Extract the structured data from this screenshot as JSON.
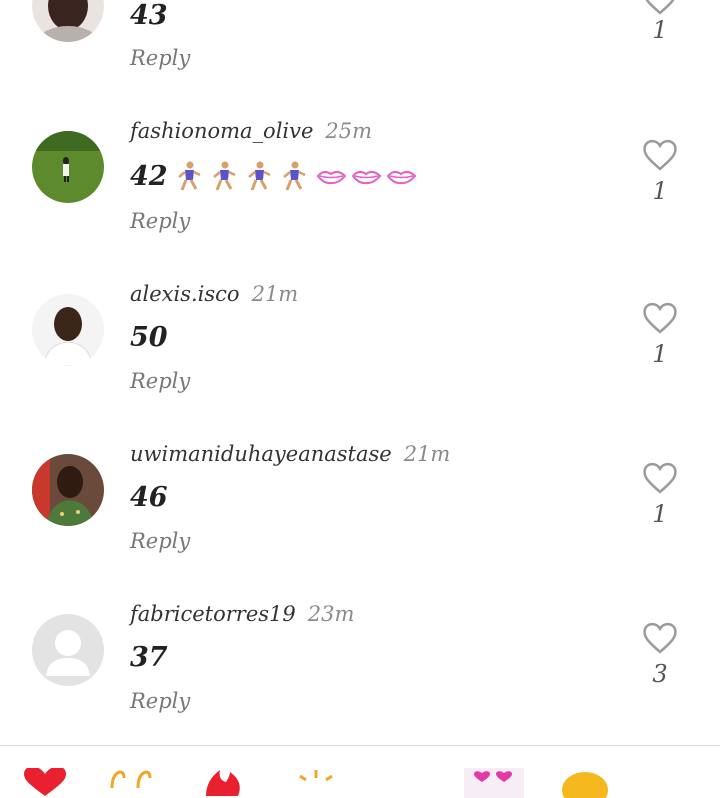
{
  "comments": [
    {
      "username": "",
      "time": "",
      "text": "43",
      "reply_label": "Reply",
      "likes": "1",
      "avatar_icon": "person-photo-icon"
    },
    {
      "username": "fashionoma_olive",
      "time": "25m",
      "text": "42",
      "reply_label": "Reply",
      "likes": "1",
      "emojis": [
        "runner-icon",
        "runner-icon",
        "runner-icon",
        "runner-icon",
        "lips-icon",
        "lips-icon",
        "lips-icon"
      ],
      "avatar_icon": "grass-field-photo-icon"
    },
    {
      "username": "alexis.isco",
      "time": "21m",
      "text": "50",
      "reply_label": "Reply",
      "likes": "1",
      "avatar_icon": "person-photo-icon"
    },
    {
      "username": "uwimaniduhayeanastase",
      "time": "21m",
      "text": "46",
      "reply_label": "Reply",
      "likes": "1",
      "avatar_icon": "person-photo-icon"
    },
    {
      "username": "fabricetorres19",
      "time": "23m",
      "text": "37",
      "reply_label": "Reply",
      "likes": "3",
      "avatar_icon": "default-avatar-icon"
    }
  ],
  "quick_emojis": [
    "heart-icon",
    "hands-icon",
    "fire-icon",
    "sparkle-icon",
    "heart-eyes-icon",
    "smiley-icon"
  ],
  "colors": {
    "like_outline": "#9a9a9a",
    "time_text": "#8a8a8a",
    "reply_text": "#777777",
    "lips": "#e65fc7",
    "runner_shirt": "#5d52c8"
  }
}
